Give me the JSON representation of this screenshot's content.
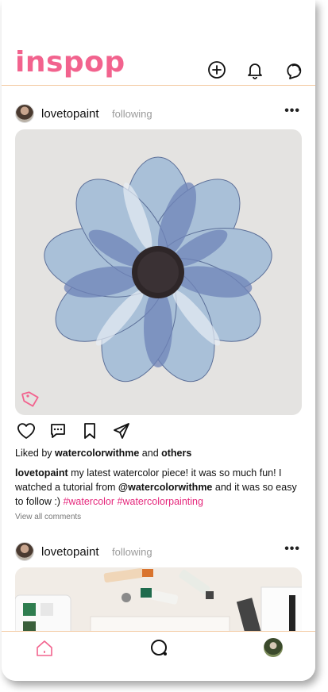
{
  "app": {
    "logo_text": "inspop"
  },
  "colors": {
    "brand": "#f2638e",
    "hashtag": "#e5287c",
    "divider": "#f3c9a0"
  },
  "header": {
    "icons": [
      "plus-circle-icon",
      "bell-icon",
      "chat-icon"
    ]
  },
  "posts": [
    {
      "username": "lovetopaint",
      "follow_status": "following",
      "more_label": "•••",
      "liked_by_prefix": "Liked by ",
      "liked_by_user": "watercolorwithme",
      "liked_by_and": " and ",
      "liked_by_others": "others",
      "caption_user": "lovetopaint",
      "caption_text_1": " my latest watercolor piece! it was so much fun! I watched a tutorial from ",
      "caption_mention": "@watercolorwithme",
      "caption_text_2": " and it was so easy to follow :) ",
      "caption_hashtags": "#watercolor #watercolorpainting",
      "view_comments": "View all comments"
    },
    {
      "username": "lovetopaint",
      "follow_status": "following",
      "more_label": "•••"
    }
  ],
  "bottom_nav": {
    "items": [
      "home-icon",
      "search-icon",
      "profile-avatar"
    ]
  }
}
